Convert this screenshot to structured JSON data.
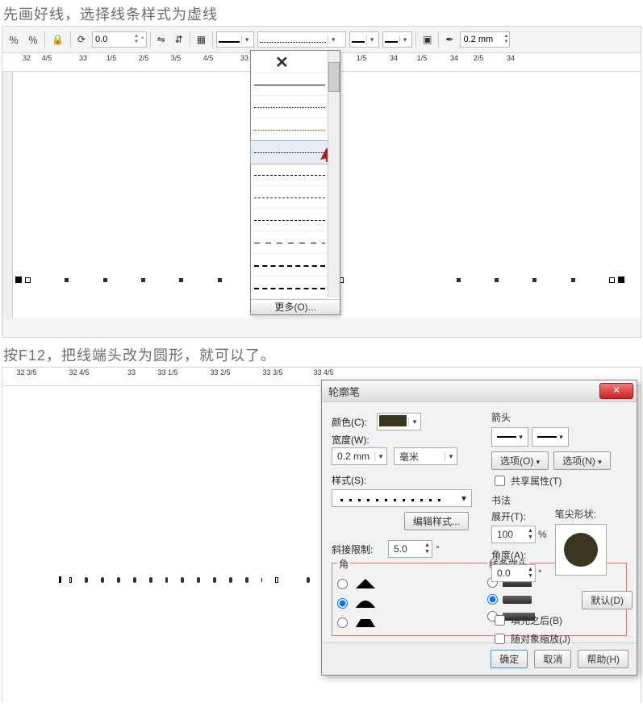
{
  "caption1": "先画好线，选择线条样式为虚线",
  "caption2": "按F12，把线端头改为圆形，就可以了。",
  "toolbar": {
    "rotation_value": "0.0",
    "width_value": "0.2 mm",
    "line_style_more": "更多(O)..."
  },
  "ruler1": {
    "major": [
      "32",
      "33",
      "",
      "34"
    ],
    "minor": [
      "4/5",
      "1/5",
      "2/5",
      "3/5",
      "4/5",
      "1/5",
      "2/5",
      "3/5",
      "4/5",
      "1/5",
      "2/5",
      "3/5"
    ]
  },
  "ruler2": {
    "labels": [
      "32 3/5",
      "32 4/5",
      "33",
      "33 1/5",
      "33 2/5",
      "33 3/5",
      "33 4/5"
    ]
  },
  "dialog": {
    "title": "轮廓笔",
    "color_label": "颜色(C):",
    "width_label": "宽度(W):",
    "width_value": "0.2 mm",
    "unit_value": "毫米",
    "style_label": "样式(S):",
    "edit_style_btn": "编辑样式...",
    "miter_label": "斜接限制:",
    "miter_value": "5.0",
    "corners_label": "角",
    "caps_label": "线条端头",
    "arrow_label": "箭头",
    "options_btn1": "选项(O)",
    "options_btn2": "选项(N)",
    "share_attr": "共享属性(T)",
    "calligraphy_label": "书法",
    "stretch_label": "展开(T):",
    "stretch_value": "100",
    "stretch_unit": "%",
    "angle_label": "角度(A):",
    "angle_value": "0.0",
    "nib_label": "笔尖形状:",
    "default_btn": "默认(D)",
    "behind_fill": "填充之后(B)",
    "scale_with": "随对象缩放(J)",
    "ok": "确定",
    "cancel": "取消",
    "help": "帮助(H)"
  }
}
